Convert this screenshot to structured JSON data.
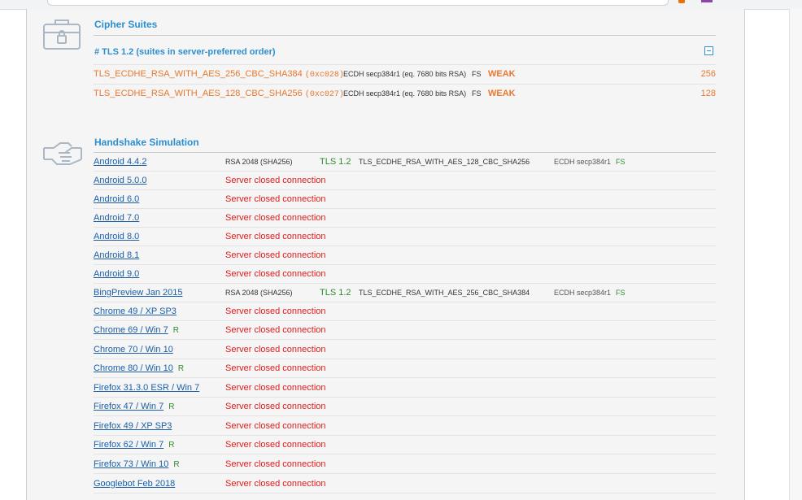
{
  "cipher_suites": {
    "title": "Cipher Suites",
    "subheading": "# TLS 1.2 (suites in server-preferred order)",
    "rows": [
      {
        "name": "TLS_ECDHE_RSA_WITH_AES_256_CBC_SHA384",
        "hex": "(0xc028)",
        "kx": "ECDH secp384r1 (eq. 7680 bits RSA)",
        "fs": "FS",
        "flag": "WEAK",
        "bits": "256"
      },
      {
        "name": "TLS_ECDHE_RSA_WITH_AES_128_CBC_SHA256",
        "hex": "(0xc027)",
        "kx": "ECDH secp384r1 (eq. 7680 bits RSA)",
        "fs": "FS",
        "flag": "WEAK",
        "bits": "128"
      }
    ]
  },
  "handshake": {
    "title": "Handshake Simulation",
    "rows": [
      {
        "client": "Android 4.4.2",
        "r": "",
        "cert": "RSA 2048 (SHA256)",
        "proto": "TLS 1.2",
        "suite": "TLS_ECDHE_RSA_WITH_AES_128_CBC_SHA256",
        "kx": "ECDH secp384r1",
        "fs": "FS",
        "status": ""
      },
      {
        "client": "Android 5.0.0",
        "r": "",
        "status": "Server closed connection"
      },
      {
        "client": "Android 6.0",
        "r": "",
        "status": "Server closed connection"
      },
      {
        "client": "Android 7.0",
        "r": "",
        "status": "Server closed connection"
      },
      {
        "client": "Android 8.0",
        "r": "",
        "status": "Server closed connection"
      },
      {
        "client": "Android 8.1",
        "r": "",
        "status": "Server closed connection"
      },
      {
        "client": "Android 9.0",
        "r": "",
        "status": "Server closed connection"
      },
      {
        "client": "BingPreview Jan 2015",
        "r": "",
        "cert": "RSA 2048 (SHA256)",
        "proto": "TLS 1.2",
        "suite": "TLS_ECDHE_RSA_WITH_AES_256_CBC_SHA384",
        "kx": "ECDH secp384r1",
        "fs": "FS",
        "status": ""
      },
      {
        "client": "Chrome 49 / XP SP3",
        "r": "",
        "status": "Server closed connection"
      },
      {
        "client": "Chrome 69 / Win 7",
        "r": "R",
        "status": "Server closed connection"
      },
      {
        "client": "Chrome 70 / Win 10",
        "r": "",
        "status": "Server closed connection"
      },
      {
        "client": "Chrome 80 / Win 10",
        "r": "R",
        "status": "Server closed connection"
      },
      {
        "client": "Firefox 31.3.0 ESR / Win 7",
        "r": "",
        "status": "Server closed connection"
      },
      {
        "client": "Firefox 47 / Win 7",
        "r": "R",
        "status": "Server closed connection"
      },
      {
        "client": "Firefox 49 / XP SP3",
        "r": "",
        "status": "Server closed connection"
      },
      {
        "client": "Firefox 62 / Win 7",
        "r": "R",
        "status": "Server closed connection"
      },
      {
        "client": "Firefox 73 / Win 10",
        "r": "R",
        "status": "Server closed connection"
      },
      {
        "client": "Googlebot Feb 2018",
        "r": "",
        "status": "Server closed connection"
      }
    ]
  },
  "icons": {
    "cipher": "briefcase-lock-icon",
    "handshake": "handshake-icon"
  },
  "colors": {
    "accent": "#2b8fd1",
    "weak": "#e8772e",
    "error": "#e01b1b",
    "ok": "#2e8b2e",
    "link": "#1a5fa8"
  }
}
